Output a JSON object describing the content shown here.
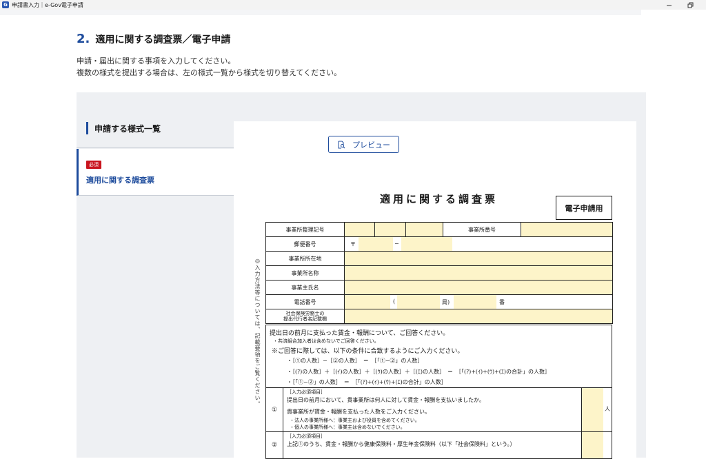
{
  "window": {
    "app_icon": "G",
    "title": "申請書入力｜e-Gov電子申請",
    "minimize_icon": "minimize-icon",
    "restore_icon": "restore-icon"
  },
  "heading": {
    "step_number": "2.",
    "title": "適用に関する調査票／電子申請",
    "desc_line1": "申請・届出に関する事項を入力してください。",
    "desc_line2": "複数の様式を提出する場合は、左の様式一覧から様式を切り替えてください。"
  },
  "form_list": {
    "title": "申請する様式一覧",
    "items": [
      {
        "badge": "必須",
        "label": "適用に関する調査票"
      }
    ]
  },
  "preview": {
    "label": "プレビュー",
    "icon": "preview-icon"
  },
  "document": {
    "title": "適用に関する調査票",
    "e_label": "電子申請用",
    "side_note": "◎入力方法等については、記載要領をご覧ください。",
    "rows": {
      "office_code": "事業所整理記号",
      "office_number": "事業所番号",
      "postal_code": "郵便番号",
      "postal_mark": "〒",
      "postal_dash": "−",
      "address": "事業所所在地",
      "office_name": "事業所名称",
      "owner_name": "事業主氏名",
      "phone": "電話番号",
      "phone_paren": "(",
      "phone_kyoku": "局)",
      "phone_ban": "番",
      "agent_line1": "社会保険労務士の",
      "agent_line2": "提出代行者名記載欄"
    },
    "question": {
      "line1": "提出日の前月に支払った賃金・報酬について、ご回答ください。",
      "line2": "・共済組合加入者は含めないでご回答ください。",
      "line3": "※ご回答に際しては、以下の条件に合致するようにご入力ください。",
      "line4": "・［①の人数］−［②の人数］　＝　［「①−②」の人数］",
      "line5": "・［(ｱ)の人数］＋［(ｲ)の人数］＋［(ｳ)の人数］＋［(ｴ)の人数］　＝　［「(ｱ)+(ｲ)+(ｳ)+(ｴ)の合計」の人数］",
      "line6": "・［「①−②」の人数］　＝　［「(ｱ)+(ｲ)+(ｳ)+(ｴ)の合計」の人数］"
    },
    "sub1": {
      "num": "①",
      "tag": "［入力必須項目］",
      "text1": "提出日の前月において、貴事業所は何人に対して賃金・報酬を支払いましたか。",
      "text2": "貴事業所が賃金・報酬を支払った人数をご入力ください。",
      "note1": "・法人の事業所様へ：事業主および役員を含めてください。",
      "note2": "・個人の事業所様へ：事業主は含めないでください。",
      "unit": "人"
    },
    "sub2": {
      "num": "②",
      "tag": "［入力必須項目］",
      "text1": "上記①のうち、賃金・報酬から健康保険料・厚生年金保険料（以下「社会保険料」という。）"
    }
  }
}
